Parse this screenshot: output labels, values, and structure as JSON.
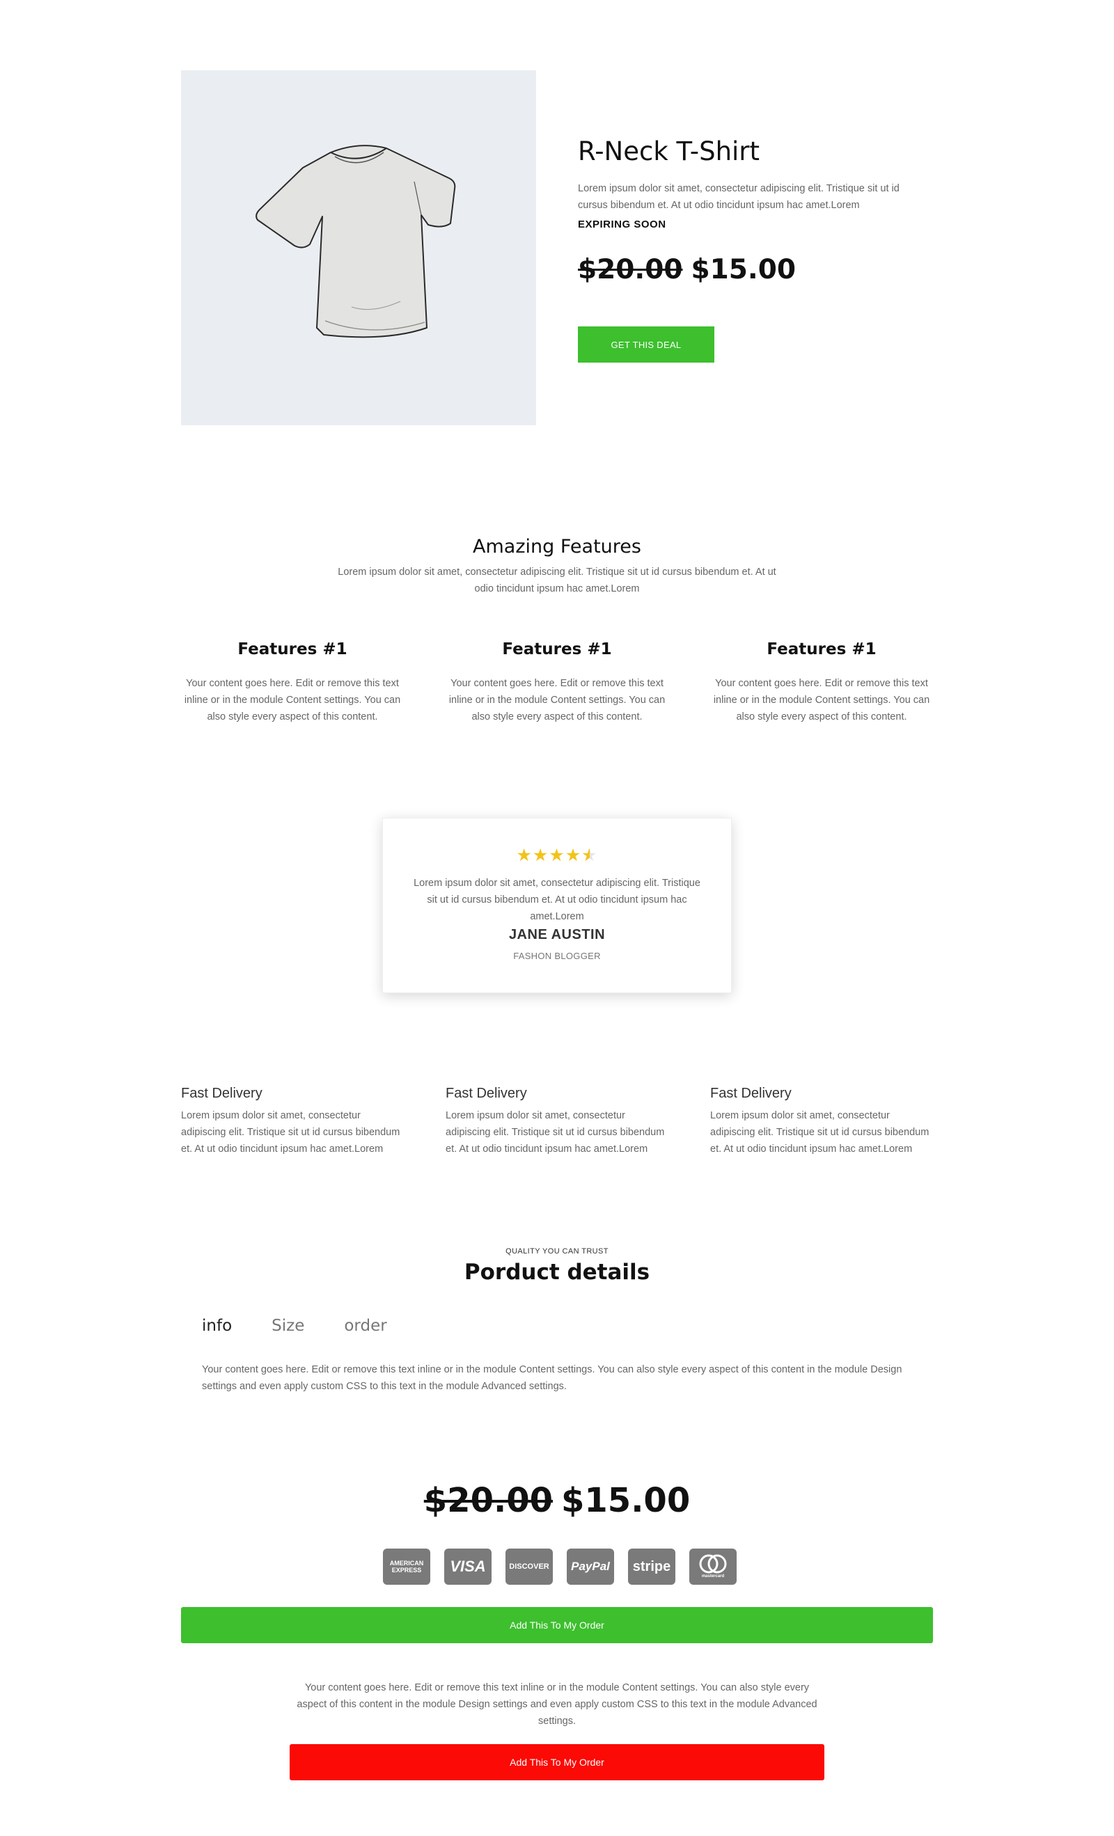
{
  "hero": {
    "title": "R-Neck T-Shirt",
    "description": "Lorem ipsum dolor sit amet, consectetur adipiscing elit. Tristique sit ut id cursus bibendum et. At ut odio tincidunt ipsum hac amet.Lorem",
    "badge": "EXPIRING SOON",
    "old_price": "$20.00",
    "new_price": "$15.00",
    "cta": "GET THIS DEAL",
    "image_bg": "#eaeef2",
    "cta_color": "#3dbf2e"
  },
  "features": {
    "title": "Amazing Features",
    "description": "Lorem ipsum dolor sit amet, consectetur adipiscing elit. Tristique sit ut id cursus bibendum et. At ut odio tincidunt ipsum hac amet.Lorem",
    "items": [
      {
        "title": "Features #1",
        "text": "Your content goes here. Edit or remove this text inline or in the module Content settings. You can also style every aspect of this content."
      },
      {
        "title": "Features #1",
        "text": "Your content goes here. Edit or remove this text inline or in the module Content settings. You can also style every aspect of this content."
      },
      {
        "title": "Features #1",
        "text": "Your content goes here. Edit or remove this text inline or in the module Content settings. You can also style every aspect of this content."
      }
    ]
  },
  "testimonial": {
    "rating": 4.5,
    "text": "Lorem ipsum dolor sit amet, consectetur adipiscing elit. Tristique sit ut id cursus bibendum et. At ut odio tincidunt ipsum hac amet.Lorem",
    "name": "JANE AUSTIN",
    "role": "FASHON BLOGGER",
    "star_color": "#f3c31b"
  },
  "delivery": [
    {
      "title": "Fast Delivery",
      "text": "Lorem ipsum dolor sit amet, consectetur adipiscing elit. Tristique sit ut id cursus bibendum et. At ut odio tincidunt ipsum hac amet.Lorem"
    },
    {
      "title": "Fast Delivery",
      "text": "Lorem ipsum dolor sit amet, consectetur adipiscing elit. Tristique sit ut id cursus bibendum et. At ut odio tincidunt ipsum hac amet.Lorem"
    },
    {
      "title": "Fast Delivery",
      "text": "Lorem ipsum dolor sit amet, consectetur adipiscing elit. Tristique sit ut id cursus bibendum et. At ut odio tincidunt ipsum hac amet.Lorem"
    }
  ],
  "details": {
    "eyebrow": "QUALITY YOU CAN TRUST",
    "title": "Porduct details",
    "tabs": [
      "info",
      "Size",
      "order"
    ],
    "active_tab": "info",
    "content": "Your content goes here. Edit or remove this text inline or in the module Content settings. You can also style every aspect of this content in the module Design settings and even apply custom CSS to this text in the module Advanced settings."
  },
  "order": {
    "old_price": "$20.00",
    "new_price": "$15.00",
    "payment_icons": [
      {
        "name": "amex-icon",
        "label": "AMERICAN EXPRESS"
      },
      {
        "name": "visa-icon",
        "label": "VISA"
      },
      {
        "name": "discover-icon",
        "label": "DISCOVER"
      },
      {
        "name": "paypal-icon",
        "label": "PayPal"
      },
      {
        "name": "stripe-icon",
        "label": "stripe"
      },
      {
        "name": "mastercard-icon",
        "label": "mastercard"
      }
    ],
    "add_button": "Add This To My Order",
    "note": "Your content goes here. Edit or remove this text inline or in the module Content settings. You can also style every aspect of this content in the module Design settings and even apply custom CSS to this text in the module Advanced settings.",
    "add_button_2": "Add This To My Order",
    "green": "#3dbf2e",
    "red": "#fb0a06"
  }
}
